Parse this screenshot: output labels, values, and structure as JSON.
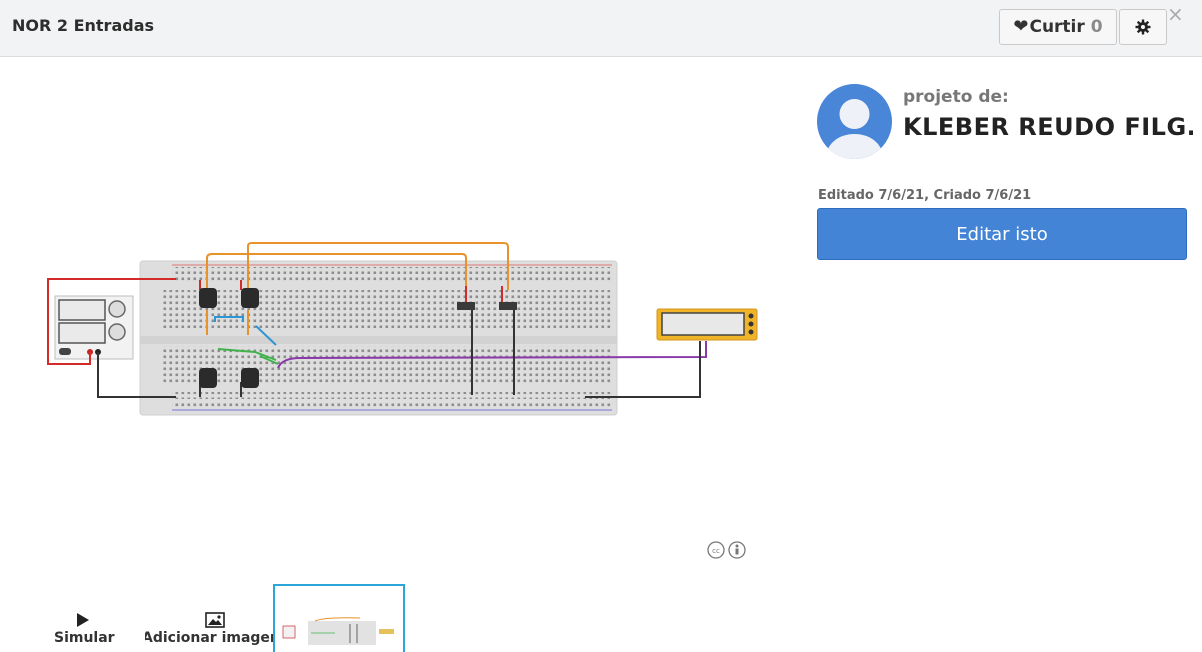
{
  "header": {
    "title": "NOR 2 Entradas",
    "like_label": "Curtir",
    "like_count": "0",
    "heart_icon": "heart-icon",
    "settings_icon": "gear-icon",
    "close_icon": "close-icon",
    "close_glyph": "×"
  },
  "author_panel": {
    "by_label": "projeto de:",
    "author_name": "KLEBER REUDO FILG...",
    "dates": "Editado 7/6/21, Criado 7/6/21",
    "edit_button": "Editar isto"
  },
  "colors": {
    "accent": "#4384d7",
    "avatar": "#4a86d8",
    "thumbnail_border": "#2aa7d8"
  },
  "toolbar": {
    "simulate_label": "Simular",
    "add_image_label": "Adicionar imagem"
  },
  "license_icon": "creative-commons-attribution-icon"
}
